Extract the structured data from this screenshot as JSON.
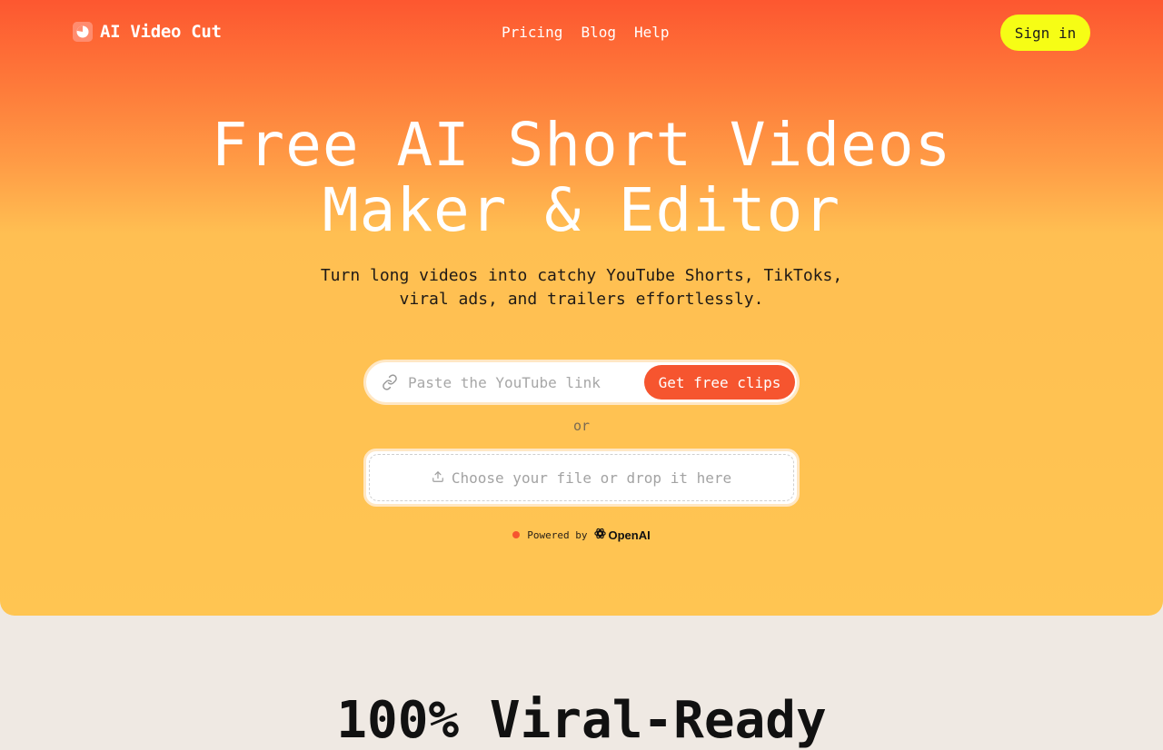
{
  "header": {
    "brand": "AI Video Cut",
    "nav": [
      {
        "label": "Pricing"
      },
      {
        "label": "Blog"
      },
      {
        "label": "Help"
      }
    ],
    "signin_label": "Sign in"
  },
  "hero": {
    "title_line1": "Free AI Short Videos",
    "title_line2": "Maker & Editor",
    "subtitle_line1": "Turn long videos into catchy YouTube Shorts, TikToks,",
    "subtitle_line2": "viral ads, and trailers effortlessly.",
    "url_placeholder": "Paste the YouTube link",
    "cta_label": "Get free clips",
    "or_label": "or",
    "drop_label": "Choose your file or drop it here",
    "powered_label": "Powered by",
    "powered_brand": "OpenAI"
  },
  "section2": {
    "title": "100% Viral-Ready"
  },
  "colors": {
    "accent": "#f6552f",
    "signin_bg": "#f6fd15",
    "hero_top": "#fd5730",
    "hero_bottom": "#ffc552"
  },
  "icons": {
    "logo": "scissors-clip-logo-icon",
    "link": "link-icon",
    "upload": "upload-icon",
    "openai": "openai-logo-icon"
  }
}
